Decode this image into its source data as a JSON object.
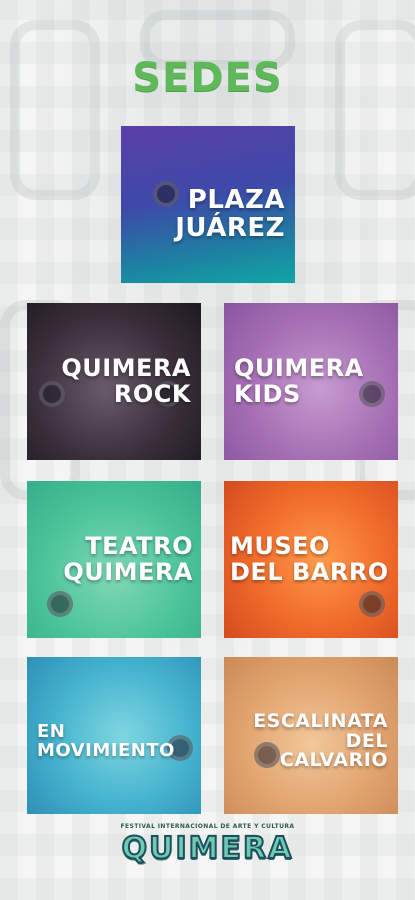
{
  "header": {
    "title": "SEDES"
  },
  "venues": [
    {
      "lines": [
        "PLAZA",
        "JUÁREZ"
      ]
    },
    {
      "lines": [
        "QUIMERA",
        "ROCK"
      ]
    },
    {
      "lines": [
        "QUIMERA",
        "KIDS"
      ]
    },
    {
      "lines": [
        "TEATRO",
        "QUIMERA"
      ]
    },
    {
      "lines": [
        "MUSEO",
        "DEL BARRO"
      ]
    },
    {
      "lines": [
        "EN",
        "MOVIMIENTO"
      ]
    },
    {
      "lines": [
        "ESCALINATA",
        "DEL",
        "CALVARIO"
      ]
    }
  ],
  "footer": {
    "logo_subtitle": "FESTIVAL INTERNACIONAL DE ARTE Y CULTURA",
    "logo_text": "QUIMERA"
  },
  "colors": {
    "title_green": "#5fb95a",
    "plaza": "#3d4aa8",
    "rock": "#2b262b",
    "kids": "#a66fb4",
    "teatro": "#4cc49a",
    "museo": "#f06a2a",
    "movimiento": "#45b3cf",
    "escalinata": "#e2a46f"
  }
}
